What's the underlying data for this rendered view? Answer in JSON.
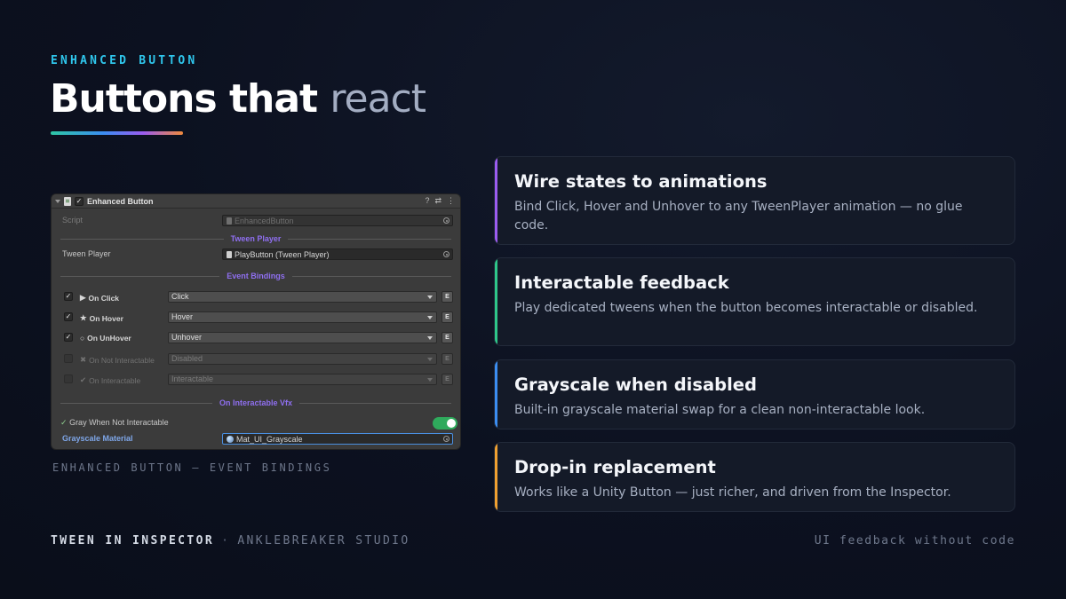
{
  "eyebrow": "ENHANCED BUTTON",
  "title": {
    "main": "Buttons that",
    "muted": "react"
  },
  "inspector": {
    "component_title": "Enhanced Button",
    "script": {
      "label": "Script",
      "value": "EnhancedButton"
    },
    "sections": {
      "tween_player": "Tween Player",
      "event_bindings": "Event Bindings",
      "vfx": "On Interactable Vfx"
    },
    "tween_player": {
      "label": "Tween Player",
      "value": "PlayButton (Tween Player)"
    },
    "events": [
      {
        "glyph": "▶",
        "label": "On Click",
        "value": "Click",
        "checked": true
      },
      {
        "glyph": "★",
        "label": "On Hover",
        "value": "Hover",
        "checked": true
      },
      {
        "glyph": "○",
        "label": "On UnHover",
        "value": "Unhover",
        "checked": true
      },
      {
        "glyph": "✖",
        "label": "On Not Interactable",
        "value": "Disabled",
        "checked": false
      },
      {
        "glyph": "✔",
        "label": "On Interactable",
        "value": "Interactable",
        "checked": false
      }
    ],
    "e_label": "E",
    "gray_toggle": {
      "check": "✓",
      "label": "Gray When Not Interactable",
      "on": true
    },
    "material": {
      "label": "Grayscale Material",
      "value": "Mat_UI_Grayscale"
    },
    "header_icons": [
      "?",
      "⇄",
      "⋮"
    ]
  },
  "caption": "ENHANCED BUTTON — EVENT BINDINGS",
  "features": [
    {
      "title": "Wire states to animations",
      "desc": "Bind Click, Hover and Unhover to any TweenPlayer animation — no glue code.",
      "accent": "#9b5cf0"
    },
    {
      "title": "Interactable feedback",
      "desc": "Play dedicated tweens when the button becomes interactable or disabled.",
      "accent": "#2ec78a"
    },
    {
      "title": "Grayscale when disabled",
      "desc": "Built-in grayscale material swap for a clean non-interactable look.",
      "accent": "#3b8df2"
    },
    {
      "title": "Drop-in replacement",
      "desc": "Works like a Unity Button — just richer, and driven from the Inspector.",
      "accent": "#f0a030"
    }
  ],
  "footer": {
    "brand": "TWEEN IN INSPECTOR",
    "separator": "·",
    "studio": "ANKLEBREAKER STUDIO",
    "tagline": "UI feedback without code"
  },
  "colors": {
    "eyebrow": "#2fc6ec",
    "section_title": "#8f6ff0",
    "toggle_on": "#2faa5c"
  }
}
